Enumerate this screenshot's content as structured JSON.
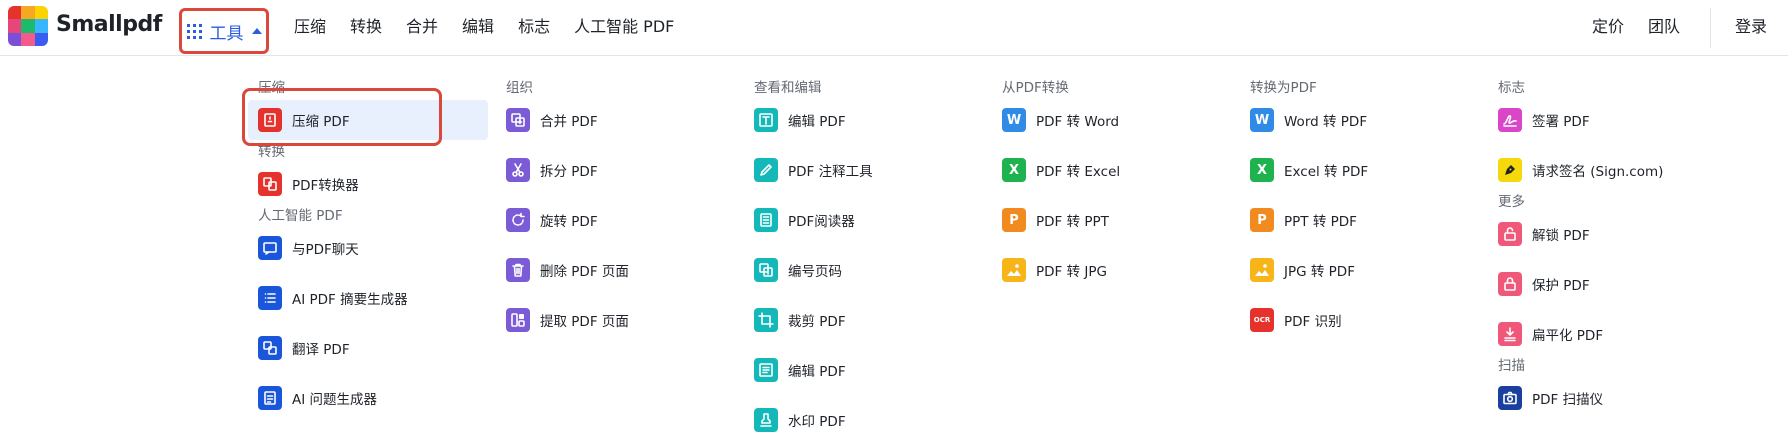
{
  "brand": "Smallpdf",
  "logo_colors": [
    "#e5322d",
    "#f7a823",
    "#fbd300",
    "#e8457c",
    "#1eb96b",
    "#38b6ff",
    "#7b4fd6",
    "#f25c8a",
    "#3b5cf2"
  ],
  "tools_label": "工具",
  "nav": [
    "压缩",
    "转换",
    "合并",
    "编辑",
    "标志",
    "人工智能 PDF"
  ],
  "nav_right": {
    "pricing": "定价",
    "team": "团队",
    "login": "登录"
  },
  "columns": [
    {
      "sections": [
        {
          "title": "压缩",
          "items": [
            {
              "label": "压缩 PDF",
              "icon": "compress-icon",
              "color": "#e5322d"
            }
          ]
        },
        {
          "title": "转换",
          "items": [
            {
              "label": "PDF转换器",
              "icon": "convert-icon",
              "color": "#e5322d"
            }
          ]
        },
        {
          "title": "人工智能 PDF",
          "items": [
            {
              "label": "与PDF聊天",
              "icon": "ai-chat-icon",
              "color": "#1a56db"
            },
            {
              "label": "AI PDF 摘要生成器",
              "icon": "list-icon",
              "color": "#1a56db"
            },
            {
              "label": "翻译 PDF",
              "icon": "translate-icon",
              "color": "#1a56db"
            },
            {
              "label": "AI 问题生成器",
              "icon": "question-doc-icon",
              "color": "#1a56db"
            }
          ]
        }
      ]
    },
    {
      "sections": [
        {
          "title": "组织",
          "items": [
            {
              "label": "合并 PDF",
              "icon": "merge-icon",
              "color": "#7b5cd6"
            },
            {
              "label": "拆分 PDF",
              "icon": "scissors-icon",
              "color": "#7b5cd6"
            },
            {
              "label": "旋转 PDF",
              "icon": "rotate-icon",
              "color": "#7b5cd6"
            },
            {
              "label": "删除 PDF 页面",
              "icon": "trash-icon",
              "color": "#7b5cd6"
            },
            {
              "label": "提取 PDF 页面",
              "icon": "extract-icon",
              "color": "#7b5cd6"
            }
          ]
        }
      ]
    },
    {
      "sections": [
        {
          "title": "查看和编辑",
          "items": [
            {
              "label": "编辑 PDF",
              "icon": "text-edit-icon",
              "color": "#14b8b8"
            },
            {
              "label": "PDF 注释工具",
              "icon": "pen-icon",
              "color": "#14b8b8"
            },
            {
              "label": "PDF阅读器",
              "icon": "reader-icon",
              "color": "#14b8b8"
            },
            {
              "label": "编号页码",
              "icon": "page-number-icon",
              "color": "#14b8b8"
            },
            {
              "label": "裁剪 PDF",
              "icon": "crop-icon",
              "color": "#14b8b8"
            },
            {
              "label": "编辑 PDF",
              "icon": "form-edit-icon",
              "color": "#14b8b8"
            },
            {
              "label": "水印 PDF",
              "icon": "stamp-icon",
              "color": "#14b8b8"
            }
          ]
        }
      ]
    },
    {
      "sections": [
        {
          "title": "从PDF转换",
          "items": [
            {
              "label": "PDF 转 Word",
              "icon": "word-icon",
              "color": "#2f8be6",
              "glyph": "W"
            },
            {
              "label": "PDF 转 Excel",
              "icon": "excel-icon",
              "color": "#1eb34f",
              "glyph": "X"
            },
            {
              "label": "PDF 转 PPT",
              "icon": "ppt-icon",
              "color": "#f28b1f",
              "glyph": "P"
            },
            {
              "label": "PDF 转 JPG",
              "icon": "jpg-icon",
              "color": "#f7b51a"
            }
          ]
        }
      ]
    },
    {
      "sections": [
        {
          "title": "转换为PDF",
          "items": [
            {
              "label": "Word 转 PDF",
              "icon": "word-icon",
              "color": "#2f8be6",
              "glyph": "W"
            },
            {
              "label": "Excel 转 PDF",
              "icon": "excel-icon",
              "color": "#1eb34f",
              "glyph": "X"
            },
            {
              "label": "PPT 转 PDF",
              "icon": "ppt-icon",
              "color": "#f28b1f",
              "glyph": "P"
            },
            {
              "label": "JPG 转 PDF",
              "icon": "jpg-icon",
              "color": "#f7b51a"
            },
            {
              "label": "PDF 识别",
              "icon": "ocr-icon",
              "color": "#e5322d",
              "glyph": "OCR"
            }
          ]
        }
      ]
    },
    {
      "sections": [
        {
          "title": "标志",
          "items": [
            {
              "label": "签署 PDF",
              "icon": "signature-icon",
              "color": "#d946c8"
            },
            {
              "label": "请求签名 (Sign.com)",
              "icon": "pen-nib-icon",
              "color": "#f5d90a"
            }
          ]
        },
        {
          "title": "更多",
          "items": [
            {
              "label": "解锁 PDF",
              "icon": "unlock-icon",
              "color": "#f0587a"
            },
            {
              "label": "保护 PDF",
              "icon": "lock-icon",
              "color": "#f0587a"
            },
            {
              "label": "扁平化 PDF",
              "icon": "flatten-icon",
              "color": "#f0587a"
            }
          ]
        },
        {
          "title": "扫描",
          "items": [
            {
              "label": "PDF 扫描仪",
              "icon": "camera-icon",
              "color": "#1a3f9e"
            }
          ]
        }
      ]
    }
  ]
}
